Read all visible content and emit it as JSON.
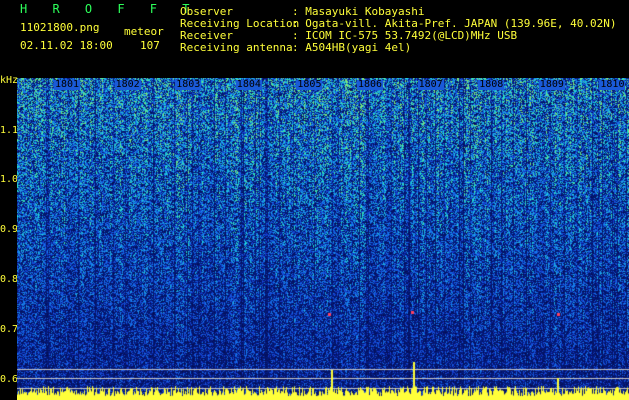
{
  "header": {
    "app_title": "H R O F F T",
    "filename": "11021800.png",
    "datetime": "02.11.02 18:00",
    "meteor_label": "meteor",
    "meteor_count": "107",
    "fields": [
      {
        "label": "Observer",
        "value": ": Masayuki Kobayashi"
      },
      {
        "label": "Receiving Location",
        "value": ": Ogata-vill. Akita-Pref. JAPAN (139.96E, 40.02N)"
      },
      {
        "label": "Receiver",
        "value": ": ICOM IC-575 53.7492(@LCD)MHz USB"
      },
      {
        "label": "Receiving antenna",
        "value": ": A504HB(yagi 4el)"
      }
    ]
  },
  "axis": {
    "unit": "kHz",
    "ticks": [
      "1.1",
      "1.0",
      "0.9",
      "0.8",
      "0.7",
      "0.6"
    ],
    "time_labels": [
      "1801",
      "1802",
      "1803",
      "1804",
      "1805",
      "1806",
      "1807",
      "1808",
      "1809",
      "1810"
    ]
  },
  "colors": {
    "label_green": "#2cff5a",
    "label_yellow": "#ffff3a",
    "noise_deep": "#0a1a6e",
    "noise_mid": "#2050d8",
    "noise_light": "#30c0e0",
    "noise_peak": "#40ff80",
    "baseline": "#ffff3a"
  }
}
